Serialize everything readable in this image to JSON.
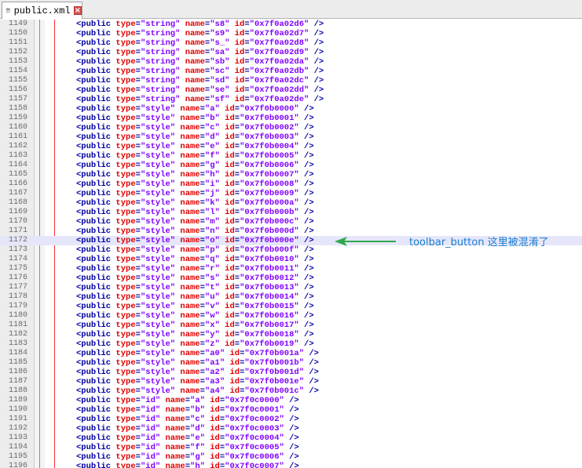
{
  "tab": {
    "title": "public.xml",
    "close_glyph": "×"
  },
  "annotation": {
    "text": "toolbar_button 这里被混淆了",
    "color": "#1a7fd0",
    "arrow_color": "#2fa84f"
  },
  "highlight_line": 1172,
  "lines": [
    {
      "n": 1149,
      "t": "string",
      "name": "s8",
      "id": "0x7f0a02d6"
    },
    {
      "n": 1150,
      "t": "string",
      "name": "s9",
      "id": "0x7f0a02d7"
    },
    {
      "n": 1151,
      "t": "string",
      "name": "s_",
      "id": "0x7f0a02d8"
    },
    {
      "n": 1152,
      "t": "string",
      "name": "sa",
      "id": "0x7f0a02d9"
    },
    {
      "n": 1153,
      "t": "string",
      "name": "sb",
      "id": "0x7f0a02da"
    },
    {
      "n": 1154,
      "t": "string",
      "name": "sc",
      "id": "0x7f0a02db"
    },
    {
      "n": 1155,
      "t": "string",
      "name": "sd",
      "id": "0x7f0a02dc"
    },
    {
      "n": 1156,
      "t": "string",
      "name": "se",
      "id": "0x7f0a02dd"
    },
    {
      "n": 1157,
      "t": "string",
      "name": "sf",
      "id": "0x7f0a02de"
    },
    {
      "n": 1158,
      "t": "style",
      "name": "a",
      "id": "0x7f0b0000"
    },
    {
      "n": 1159,
      "t": "style",
      "name": "b",
      "id": "0x7f0b0001"
    },
    {
      "n": 1160,
      "t": "style",
      "name": "c",
      "id": "0x7f0b0002"
    },
    {
      "n": 1161,
      "t": "style",
      "name": "d",
      "id": "0x7f0b0003"
    },
    {
      "n": 1162,
      "t": "style",
      "name": "e",
      "id": "0x7f0b0004"
    },
    {
      "n": 1163,
      "t": "style",
      "name": "f",
      "id": "0x7f0b0005"
    },
    {
      "n": 1164,
      "t": "style",
      "name": "g",
      "id": "0x7f0b0006"
    },
    {
      "n": 1165,
      "t": "style",
      "name": "h",
      "id": "0x7f0b0007"
    },
    {
      "n": 1166,
      "t": "style",
      "name": "i",
      "id": "0x7f0b0008"
    },
    {
      "n": 1167,
      "t": "style",
      "name": "j",
      "id": "0x7f0b0009"
    },
    {
      "n": 1168,
      "t": "style",
      "name": "k",
      "id": "0x7f0b000a"
    },
    {
      "n": 1169,
      "t": "style",
      "name": "l",
      "id": "0x7f0b000b"
    },
    {
      "n": 1170,
      "t": "style",
      "name": "m",
      "id": "0x7f0b000c"
    },
    {
      "n": 1171,
      "t": "style",
      "name": "n",
      "id": "0x7f0b000d"
    },
    {
      "n": 1172,
      "t": "style",
      "name": "o",
      "id": "0x7f0b000e"
    },
    {
      "n": 1173,
      "t": "style",
      "name": "p",
      "id": "0x7f0b000f"
    },
    {
      "n": 1174,
      "t": "style",
      "name": "q",
      "id": "0x7f0b0010"
    },
    {
      "n": 1175,
      "t": "style",
      "name": "r",
      "id": "0x7f0b0011"
    },
    {
      "n": 1176,
      "t": "style",
      "name": "s",
      "id": "0x7f0b0012"
    },
    {
      "n": 1177,
      "t": "style",
      "name": "t",
      "id": "0x7f0b0013"
    },
    {
      "n": 1178,
      "t": "style",
      "name": "u",
      "id": "0x7f0b0014"
    },
    {
      "n": 1179,
      "t": "style",
      "name": "v",
      "id": "0x7f0b0015"
    },
    {
      "n": 1180,
      "t": "style",
      "name": "w",
      "id": "0x7f0b0016"
    },
    {
      "n": 1181,
      "t": "style",
      "name": "x",
      "id": "0x7f0b0017"
    },
    {
      "n": 1182,
      "t": "style",
      "name": "y",
      "id": "0x7f0b0018"
    },
    {
      "n": 1183,
      "t": "style",
      "name": "z",
      "id": "0x7f0b0019"
    },
    {
      "n": 1184,
      "t": "style",
      "name": "a0",
      "id": "0x7f0b001a"
    },
    {
      "n": 1185,
      "t": "style",
      "name": "a1",
      "id": "0x7f0b001b"
    },
    {
      "n": 1186,
      "t": "style",
      "name": "a2",
      "id": "0x7f0b001d"
    },
    {
      "n": 1187,
      "t": "style",
      "name": "a3",
      "id": "0x7f0b001e"
    },
    {
      "n": 1188,
      "t": "style",
      "name": "a4",
      "id": "0x7f0b001c"
    },
    {
      "n": 1189,
      "t": "id",
      "name": "a",
      "id": "0x7f0c0000"
    },
    {
      "n": 1190,
      "t": "id",
      "name": "b",
      "id": "0x7f0c0001"
    },
    {
      "n": 1191,
      "t": "id",
      "name": "c",
      "id": "0x7f0c0002"
    },
    {
      "n": 1192,
      "t": "id",
      "name": "d",
      "id": "0x7f0c0003"
    },
    {
      "n": 1193,
      "t": "id",
      "name": "e",
      "id": "0x7f0c0004"
    },
    {
      "n": 1194,
      "t": "id",
      "name": "f",
      "id": "0x7f0c0005"
    },
    {
      "n": 1195,
      "t": "id",
      "name": "g",
      "id": "0x7f0c0006"
    },
    {
      "n": 1196,
      "t": "id",
      "name": "h",
      "id": "0x7f0c0007"
    }
  ]
}
